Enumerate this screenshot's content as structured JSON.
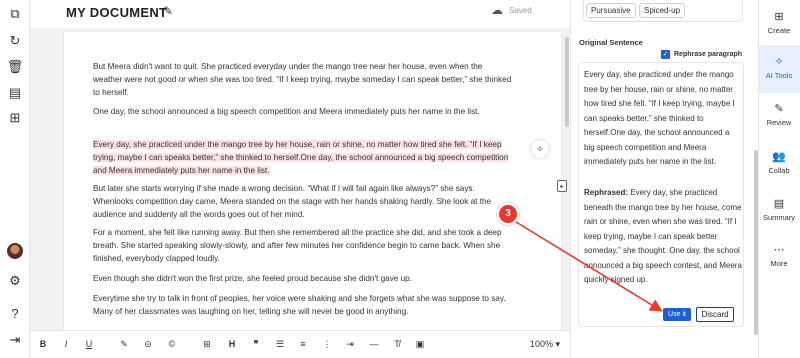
{
  "document": {
    "title": "MY DOCUMENT",
    "save_status": "Saved",
    "paragraphs": [
      "But Meera didn't want to quit. She practiced everyday under the mango tree near her house, even when the weather were not good or when she was too tired. “If I keep trying, maybe someday I can speak better,” she thinked to herself.",
      "One day, the school announced a big speech competition and Meera immediately puts her name in the list.",
      "Every day, she practiced under the mango tree by her house, rain or shine, no matter how tired she felt. “If I keep trying, maybe I can speaks better,” she thinked to herself.One day, the school announced a big speech competition and Meera immediately puts her name in the list.",
      "But later she starts worrying if she made a wrong decision. “What if I will fail again like always?” she says. Whenlooks competition day came, Meera standed on the stage with her hands shaking hardly. She look at the audience and suddenly all the words goes out of her mind.",
      "For a moment, she felt like running away. But then she remembered all the practice she did, and she took a deep breath. She started speaking slowly-slowly, and after few minutes her confidence begin to came back. When she finished, everybody clapped loudly.",
      "Even though she didn't won the first prize, she feeled proud because she didn't gave up.",
      "Everytime she try to talk in front of peoples, her voice were shaking and she forgets what she was suppose to say. Many of her classmates was laughing on her, telling she will never be good in anything."
    ],
    "zoom": "100%"
  },
  "ai_panel": {
    "tone_chips": [
      "Pursuasive",
      "Spiced-up"
    ],
    "original_sentence_label": "Original Sentence",
    "rephrase_paragraph_label": "Rephrase paragraph",
    "original_text": "Every day, she practiced under the mango tree by her house, rain or shine, no matter how tired she felt. “If I keep trying, maybe I can speaks better,” she thinked to herself.One day, the school announced a big speech competition and Meera immediately puts her name in the list.",
    "rephrased_label": "Rephrased:",
    "rephrased_text": " Every day, she practiced beneath the mango tree by her house, come rain or shine, even when she was tired. “If I keep trying, maybe I can speak better someday,” she thought. One day, the school announced a big speech contest, and Meera quickly signed up.",
    "use_label": "Use it",
    "discard_label": "Discard"
  },
  "right_rail": {
    "items": [
      {
        "label": "Create",
        "icon": "plus-square-icon"
      },
      {
        "label": "AI Tools",
        "icon": "magic-wand-icon"
      },
      {
        "label": "Review",
        "icon": "review-icon"
      },
      {
        "label": "Collab",
        "icon": "people-icon"
      },
      {
        "label": "Summary",
        "icon": "summary-icon"
      },
      {
        "label": "More",
        "icon": "more-icon"
      }
    ]
  },
  "annotation": {
    "step": "3"
  },
  "colors": {
    "accent": "#1e5fcf",
    "highlight": "#fde2e2",
    "annotation": "#e53935"
  }
}
